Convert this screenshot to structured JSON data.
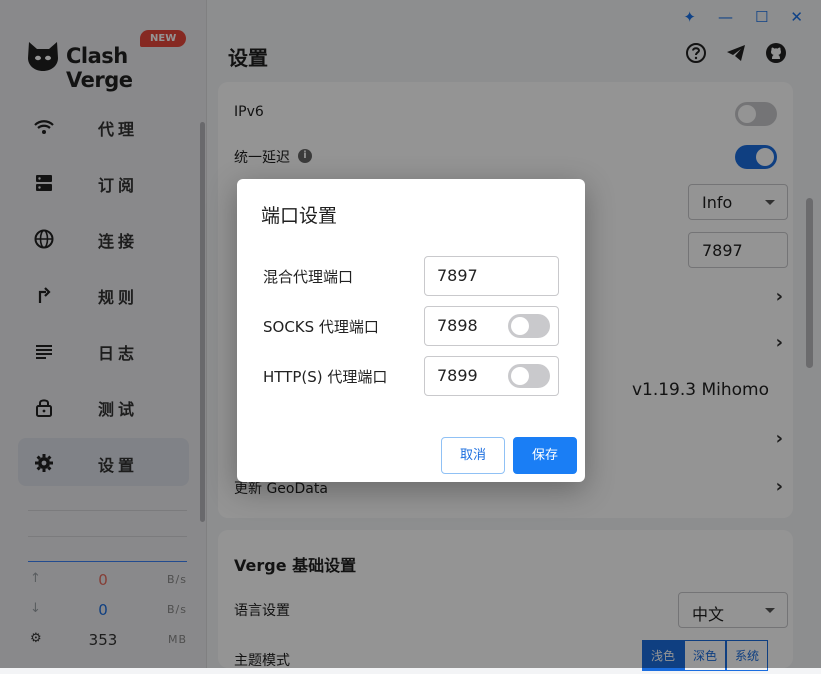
{
  "app": {
    "name": "Clash Verge",
    "badge": "NEW"
  },
  "nav": [
    {
      "label": "代理",
      "icon": "wifi-icon"
    },
    {
      "label": "订阅",
      "icon": "server-icon"
    },
    {
      "label": "连接",
      "icon": "globe-icon"
    },
    {
      "label": "规则",
      "icon": "rule-arrow-icon"
    },
    {
      "label": "日志",
      "icon": "list-icon"
    },
    {
      "label": "测试",
      "icon": "lock-icon"
    },
    {
      "label": "设置",
      "icon": "gear-icon",
      "active": true
    }
  ],
  "traffic": {
    "up": {
      "value": "0",
      "unit": "B/s",
      "icon": "arrow-up-icon",
      "color": "#e56b5e"
    },
    "down": {
      "value": "0",
      "unit": "B/s",
      "icon": "arrow-down-icon",
      "color": "#1a6ddf"
    },
    "memory": {
      "value": "353",
      "unit": "MB",
      "icon": "memory-icon"
    }
  },
  "header": {
    "title": "设置"
  },
  "clash_settings": {
    "ipv6_label": "IPv6",
    "ipv6_on": false,
    "unified_delay_label": "统一延迟",
    "unified_delay_on": true,
    "log_level": "Info",
    "port": "7897",
    "version": "v1.19.3 Mihomo",
    "geodata_label": "更新 GeoData"
  },
  "verge_settings": {
    "title": "Verge 基础设置",
    "language_label": "语言设置",
    "language_value": "中文",
    "theme_label": "主题模式",
    "theme_options": [
      "浅色",
      "深色",
      "系统"
    ]
  },
  "dialog": {
    "title": "端口设置",
    "rows": [
      {
        "label": "混合代理端口",
        "value": "7897",
        "has_toggle": false
      },
      {
        "label": "SOCKS 代理端口",
        "value": "7898",
        "has_toggle": true,
        "enabled": false
      },
      {
        "label": "HTTP(S) 代理端口",
        "value": "7899",
        "has_toggle": true,
        "enabled": false
      }
    ],
    "cancel": "取消",
    "save": "保存"
  },
  "colors": {
    "accent": "#1a7ef5",
    "active_nav": "#dde1e8"
  }
}
